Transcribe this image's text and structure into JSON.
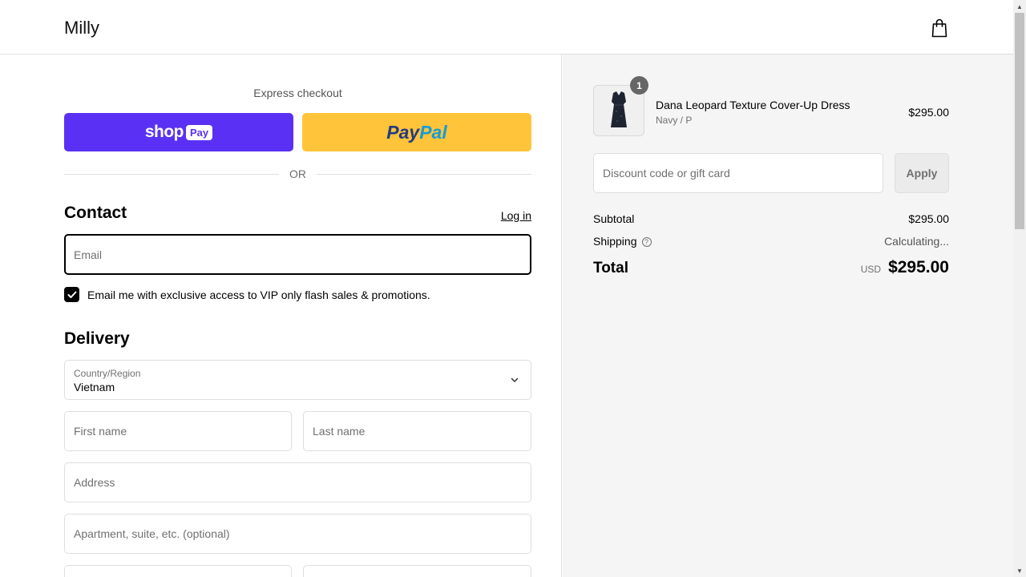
{
  "header": {
    "brand": "Milly",
    "cart_icon": "shopping-bag-icon"
  },
  "express": {
    "label": "Express checkout",
    "shop_pay_word": "shop",
    "shop_pay_badge": "Pay",
    "paypal_a": "Pay",
    "paypal_b": "Pal",
    "or_text": "OR"
  },
  "contact": {
    "heading": "Contact",
    "login_label": "Log in",
    "email_placeholder": "Email",
    "marketing_label": "Email me with exclusive access to VIP only flash sales & promotions.",
    "marketing_checked": true
  },
  "delivery": {
    "heading": "Delivery",
    "country_label": "Country/Region",
    "country_value": "Vietnam",
    "first_name_placeholder": "First name",
    "last_name_placeholder": "Last name",
    "address_placeholder": "Address",
    "apartment_placeholder": "Apartment, suite, etc. (optional)"
  },
  "summary": {
    "item": {
      "quantity": "1",
      "name": "Dana Leopard Texture Cover-Up Dress",
      "variant": "Navy / P",
      "price": "$295.00"
    },
    "discount_placeholder": "Discount code or gift card",
    "apply_label": "Apply",
    "subtotal_label": "Subtotal",
    "subtotal_value": "$295.00",
    "shipping_label": "Shipping",
    "shipping_value": "Calculating...",
    "total_label": "Total",
    "currency": "USD",
    "total_value": "$295.00"
  },
  "colors": {
    "shop_pay": "#5a31f4",
    "paypal": "#ffc439",
    "border": "#dedede",
    "summary_bg": "#f5f5f5"
  }
}
